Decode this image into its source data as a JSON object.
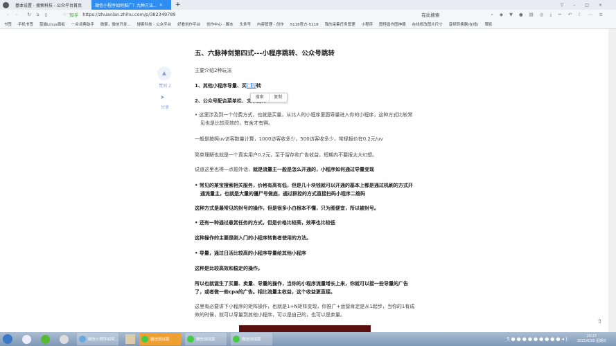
{
  "browser": {
    "tabs": [
      {
        "label": "基本设置 - 搜索科技 - 公众平台首页"
      },
      {
        "label": "微信小程序如何推广？九种方法..."
      }
    ],
    "new_tab": "+",
    "url_site": "知乎",
    "url": "https://zhuanlan.zhihu.com/p/382349789",
    "search_placeholder": "在此搜索",
    "bookmarks": [
      "书签",
      "手机书签",
      "蓝猫Linux面板",
      "一众词典助手",
      "微擎，微信开发...",
      "搜索科技 - 公众平台",
      "好看创作平台",
      "创作中心 - 脚本",
      "头条号",
      "内容管理 - 创作",
      "5118官方-5118",
      "我的采集任务管理",
      "小程序",
      "图怪兽作图神器",
      "在线修改图片尺寸",
      "音频转换器(在线)",
      "翠影"
    ]
  },
  "sidebar": {
    "like_label": "赞同 2",
    "share_label": "分享"
  },
  "popup": {
    "search": "搜索",
    "copy": "复制"
  },
  "article": {
    "heading": "五、六脉神剑第四式---小程序跳转、公众号跳转",
    "intro": "主要介绍2种玩法",
    "item1_pre": "1、其他小程序导量、买",
    "item1_sel": "量跳",
    "item1_post": "转",
    "item2": "2、公众号配合菜单栏、文章跳转",
    "bullet1": "这里涉及到一个付费方式，也就是买量，从比人的小程序里面导量进入你的小程序，这种方式比较常见也是比较高效的，有舍才有得。",
    "p1": "一般是按照uv访客数量计算，1000访客收多少，500访客收多少，常规报价在0.2元/uv",
    "p2": "简单理解也就是一个真实用户0.2元，至于留存和广告收益，短期内不要报太大幻想。",
    "p3_normal": "说道这里也得一点题外话，",
    "p3_bold": "就是流量主一般是怎么开通的，小程序如何通过导量变现",
    "bullet2": "常见的某宝搜索相关服务，价格有高有低，但是几十块钱就可以开通的基本上都是通过机刷的方式开通流量主，也就是大量的僵尸号做底，通过群控的方式直接扫码小程序二维码",
    "p4": "这种方式是最常见的封号的操作，但是很多小白根本不懂，只为图便宜，所以被封号。",
    "bullet3": "还有一种通过悬赏任务的方式，但是价格比较高，效率也比较低",
    "p5": "这种操作的主要是刚入门的小程序转售者使用的方法。",
    "bullet4": "导量，通过日活比较高的小程序导量给其他小程序",
    "p6": "这种是比较高效和稳定的操作。",
    "p7": "所以也就诞生了买量、卖量、导量的操作，当你的小程序流量增长上来，你就可以接一些导量的广告了，或者做一些cpa的广告。相比流量主收益，这个收益更直接。",
    "p8": "这里有必要讲下小程序的矩阵操作，也就是1+N矩阵变现，你推广+运营肯定是从1起步，当你的1有成效的时候，就可以导量到其他小程序，可以是自己的，也可以是卖量。"
  },
  "taskbar": {
    "items": [
      "微信小程序如何...",
      "微信测试版",
      "微信测试版",
      "微信测试版"
    ],
    "time": "20:27",
    "date": "2021/6/20 星期日"
  }
}
